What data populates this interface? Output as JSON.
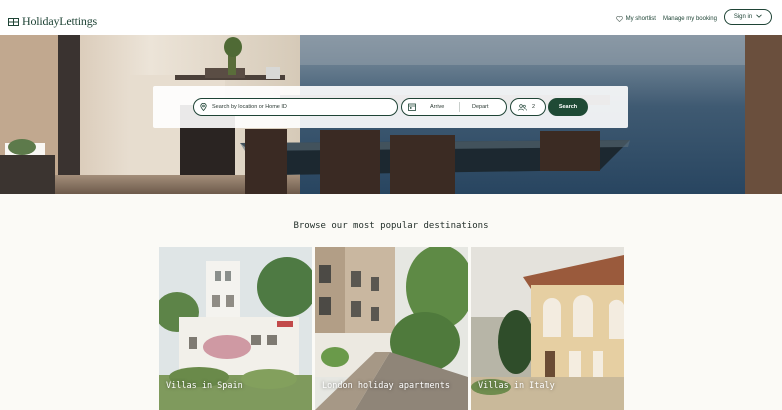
{
  "brand": {
    "name": "HolidayLettings"
  },
  "nav": {
    "shortlist": "My shortlist",
    "manage_booking": "Manage my booking",
    "sign_in": "Sign in"
  },
  "search": {
    "location_placeholder": "Search by location or Home ID",
    "arrive": "Arrive",
    "depart": "Depart",
    "guests": "2",
    "button": "Search"
  },
  "browse": {
    "title": "Browse our most popular destinations",
    "cards": [
      {
        "label": "Villas in Spain"
      },
      {
        "label": "London holiday apartments"
      },
      {
        "label": "Villas in Italy"
      }
    ]
  },
  "colors": {
    "brand_green": "#1f4a35",
    "page_bg": "#fbfaf6"
  }
}
